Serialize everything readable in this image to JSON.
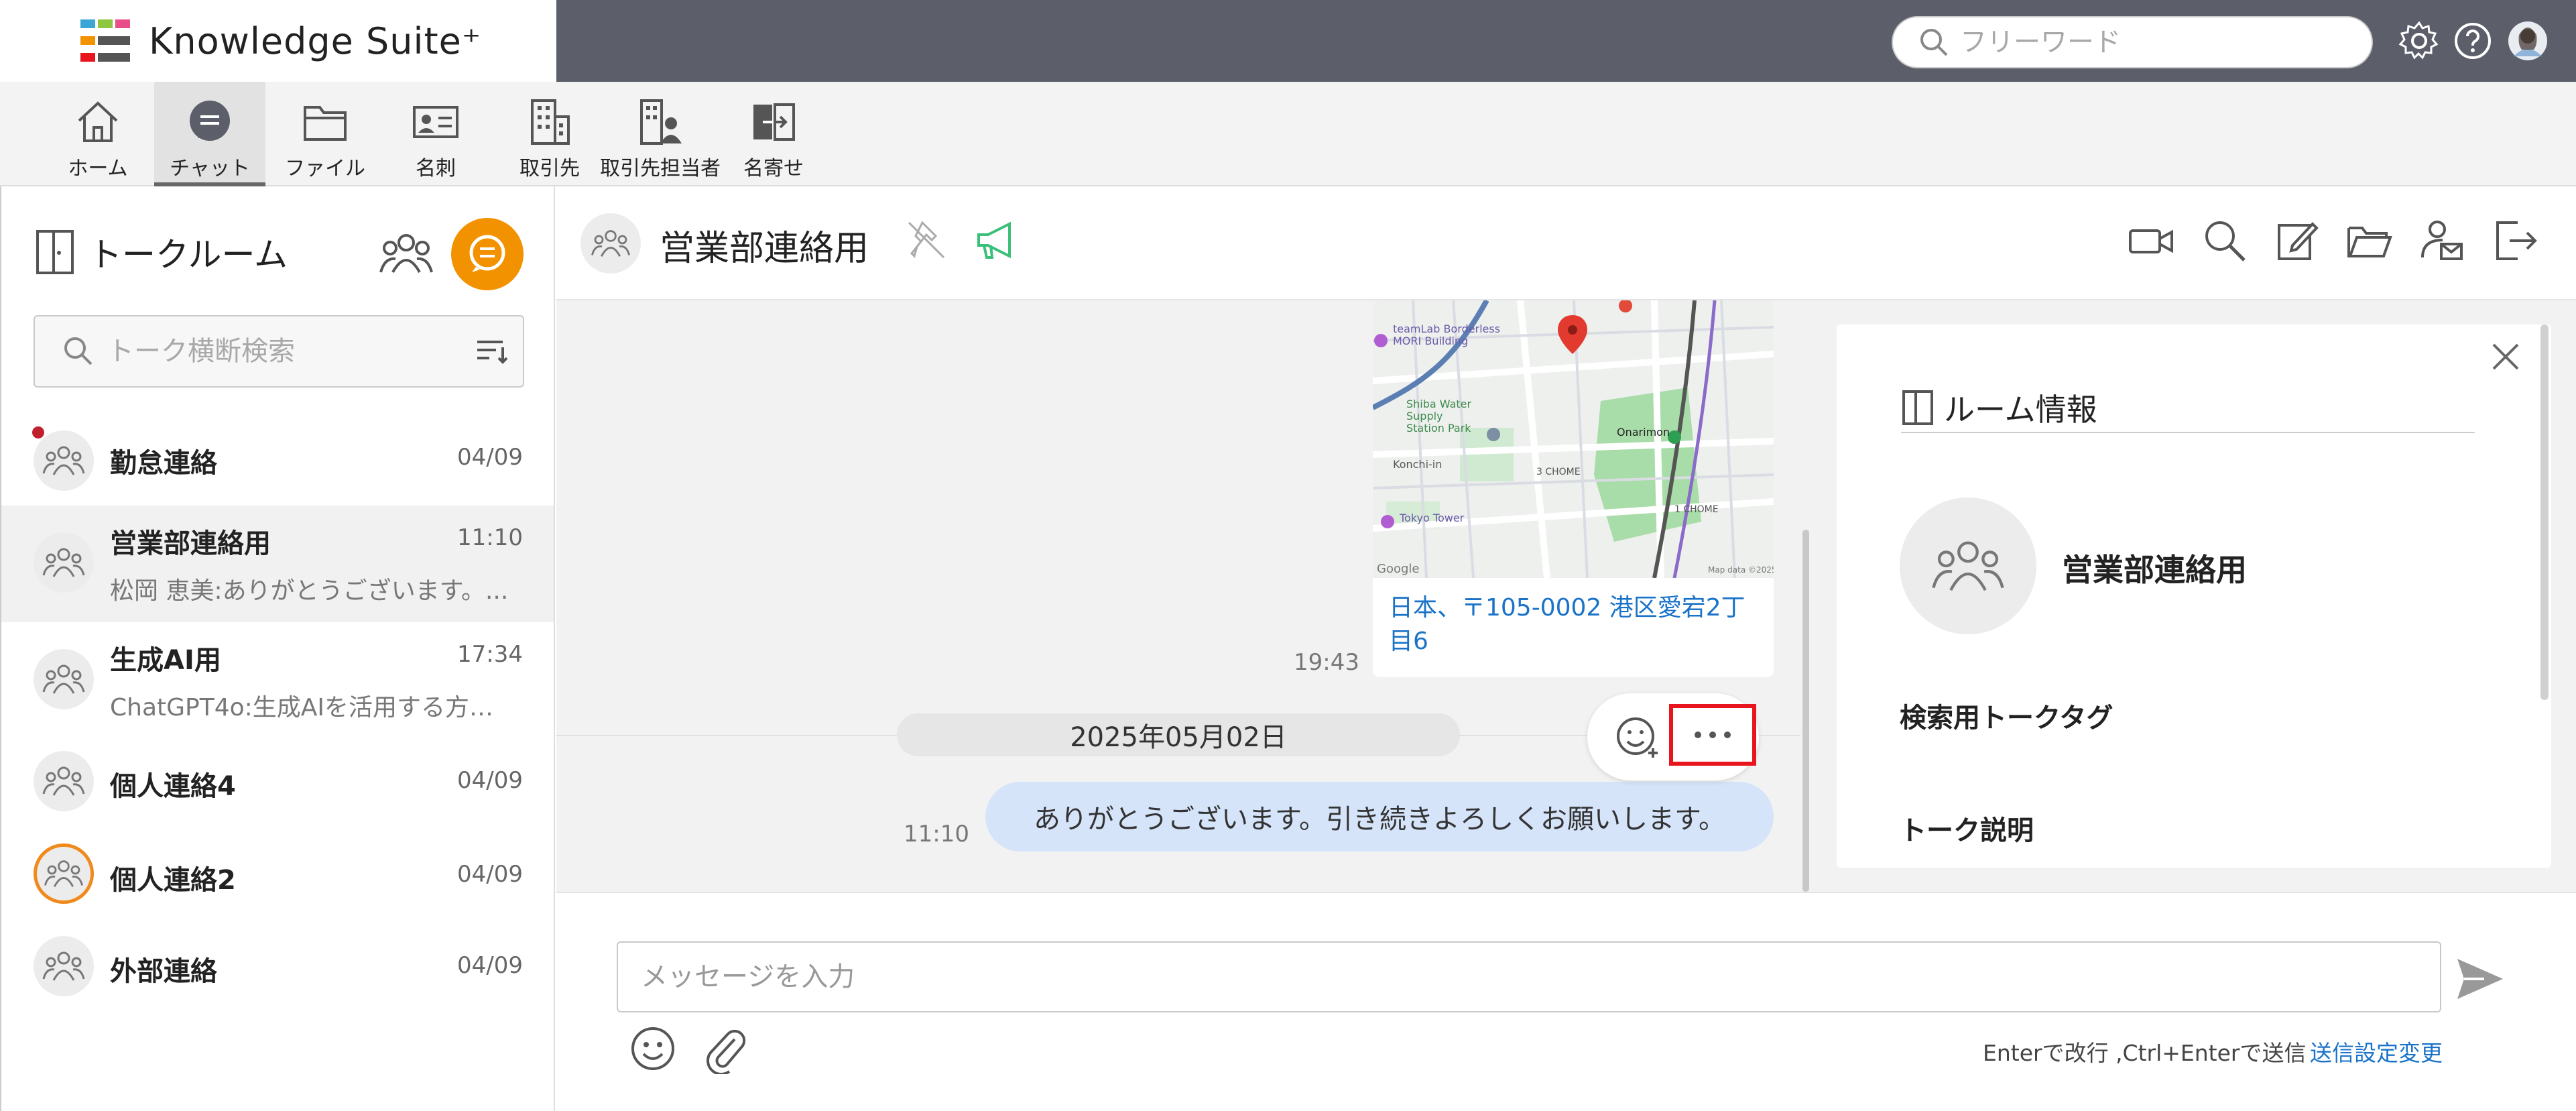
{
  "app": {
    "brand_name": "Knowledge Suite⁺"
  },
  "search": {
    "placeholder": "フリーワード"
  },
  "topbar_icons": [
    "gear-icon",
    "help-icon",
    "user-avatar"
  ],
  "nav": {
    "items": [
      {
        "label": "ホーム",
        "icon": "home-icon"
      },
      {
        "label": "チャット",
        "icon": "chat-icon",
        "active": true
      },
      {
        "label": "ファイル",
        "icon": "folder-icon"
      },
      {
        "label": "名刺",
        "icon": "business-card-icon"
      },
      {
        "label": "取引先",
        "icon": "building-icon"
      },
      {
        "label": "取引先担当者",
        "icon": "building-person-icon"
      },
      {
        "label": "名寄せ",
        "icon": "merge-icon"
      }
    ]
  },
  "sidebar": {
    "title": "トークルーム",
    "search_placeholder": "トーク横断検索",
    "rooms": [
      {
        "name": "勤怠連絡",
        "time": "04/09",
        "preview": "",
        "unread": true
      },
      {
        "name": "営業部連絡用",
        "time": "11:10",
        "preview": "松岡 恵美:ありがとうございます。...",
        "selected": true
      },
      {
        "name": "生成AI用",
        "time": "17:34",
        "preview": "ChatGPT4o:生成AIを活用する方法..."
      },
      {
        "name": "個人連絡4",
        "time": "04/09",
        "preview": ""
      },
      {
        "name": "個人連絡2",
        "time": "04/09",
        "preview": "",
        "ring": true
      },
      {
        "name": "外部連絡",
        "time": "04/09",
        "preview": ""
      }
    ]
  },
  "chat": {
    "title": "営業部連絡用",
    "map_labels": {
      "building": "teamLab Borderless\nMORI Building",
      "station": "Shiba Water Supply\nStation Park",
      "onarimon": "Onarimon",
      "area": "3 CHOME",
      "konchi": "Konchi-in",
      "tower": "Tokyo Tower",
      "area2": "1 CHOME",
      "google": "Google",
      "mapdata": "Map data ©2025"
    },
    "map_caption": "日本、〒105-0002 港区愛宕2丁目6",
    "map_time": "19:43",
    "date_separator": "2025年05月02日",
    "message_text": "ありがとうございます。引き続きよろしくお願いします。",
    "message_time": "11:10"
  },
  "room_info": {
    "title": "ルーム情報",
    "name": "営業部連絡用",
    "tag_label": "検索用トークタグ",
    "description_label": "トーク説明"
  },
  "composer": {
    "placeholder": "メッセージを入力",
    "hint": "Enterで改行 ,Ctrl+Enterで送信",
    "settings_link": "送信設定変更"
  },
  "colors": {
    "accent_orange": "#f39200",
    "link_blue": "#1a73c8",
    "bubble_blue": "#d6e4fa",
    "highlight_red": "#e8141e",
    "topbar": "#5c5f69",
    "megaphone_green": "#3bbf7a"
  }
}
